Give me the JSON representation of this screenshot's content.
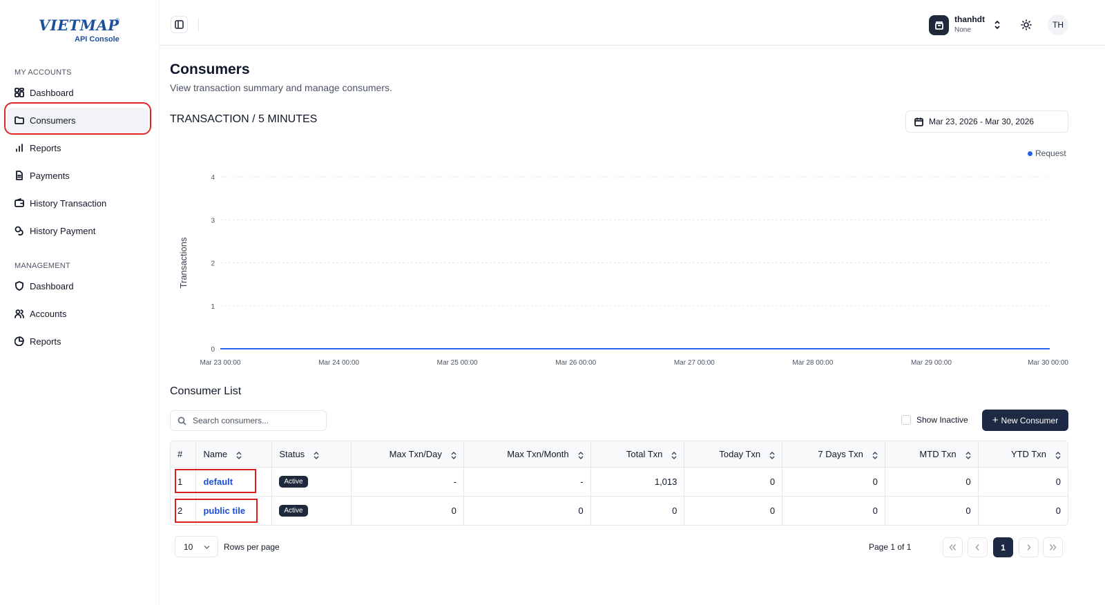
{
  "brand": {
    "name": "VIETMAP",
    "reg": "®",
    "subtitle": "API Console"
  },
  "sidebar": {
    "section1": "MY ACCOUNTS",
    "items1": [
      {
        "label": "Dashboard",
        "icon": "grid-icon"
      },
      {
        "label": "Consumers",
        "icon": "folder-icon",
        "active": true
      },
      {
        "label": "Reports",
        "icon": "bar-chart-icon"
      },
      {
        "label": "Payments",
        "icon": "file-text-icon"
      },
      {
        "label": "History Transaction",
        "icon": "wallet-icon"
      },
      {
        "label": "History Payment",
        "icon": "coins-icon"
      }
    ],
    "section2": "MANAGEMENT",
    "items2": [
      {
        "label": "Dashboard",
        "icon": "shield-icon"
      },
      {
        "label": "Accounts",
        "icon": "users-icon"
      },
      {
        "label": "Reports",
        "icon": "pie-chart-icon"
      }
    ]
  },
  "header": {
    "user": {
      "name": "thanhdt",
      "org": "None"
    },
    "avatar_initials": "TH"
  },
  "page": {
    "title": "Consumers",
    "subtitle": "View transaction summary and manage consumers.",
    "chart_title": "TRANSACTION / 5 MINUTES",
    "date_range": "Mar 23, 2026 - Mar 30, 2026"
  },
  "chart_data": {
    "type": "line",
    "ylabel": "Transactions",
    "xlabel": "",
    "ylim": [
      0,
      4
    ],
    "yticks": [
      "0",
      "1",
      "2",
      "3",
      "4"
    ],
    "x": [
      "Mar 23 00:00",
      "Mar 24 00:00",
      "Mar 25 00:00",
      "Mar 26 00:00",
      "Mar 27 00:00",
      "Mar 28 00:00",
      "Mar 29 00:00",
      "Mar 30 00:00"
    ],
    "series": [
      {
        "name": "Request",
        "color": "#2563eb",
        "values": [
          0,
          0,
          0,
          0,
          0,
          0,
          0,
          0
        ]
      }
    ],
    "grid": true,
    "legend": "top-right"
  },
  "consumers": {
    "title": "Consumer List",
    "search_placeholder": "Search consumers...",
    "show_inactive": "Show Inactive",
    "new_button": "New Consumer",
    "columns": [
      "#",
      "Name",
      "Status",
      "Max Txn/Day",
      "Max Txn/Month",
      "Total Txn",
      "Today Txn",
      "7 Days Txn",
      "MTD Txn",
      "YTD Txn"
    ],
    "rows": [
      {
        "idx": "1",
        "name": "default",
        "status": "Active",
        "max_day": "-",
        "max_month": "-",
        "total": "1,013",
        "today": "0",
        "days7": "0",
        "mtd": "0",
        "ytd": "0"
      },
      {
        "idx": "2",
        "name": "public tile",
        "status": "Active",
        "max_day": "0",
        "max_month": "0",
        "total": "0",
        "today": "0",
        "days7": "0",
        "mtd": "0",
        "ytd": "0"
      }
    ]
  },
  "pagination": {
    "rows_per_page": "10",
    "rows_label": "Rows per page",
    "page_info": "Page 1 of 1",
    "current_page": "1"
  }
}
